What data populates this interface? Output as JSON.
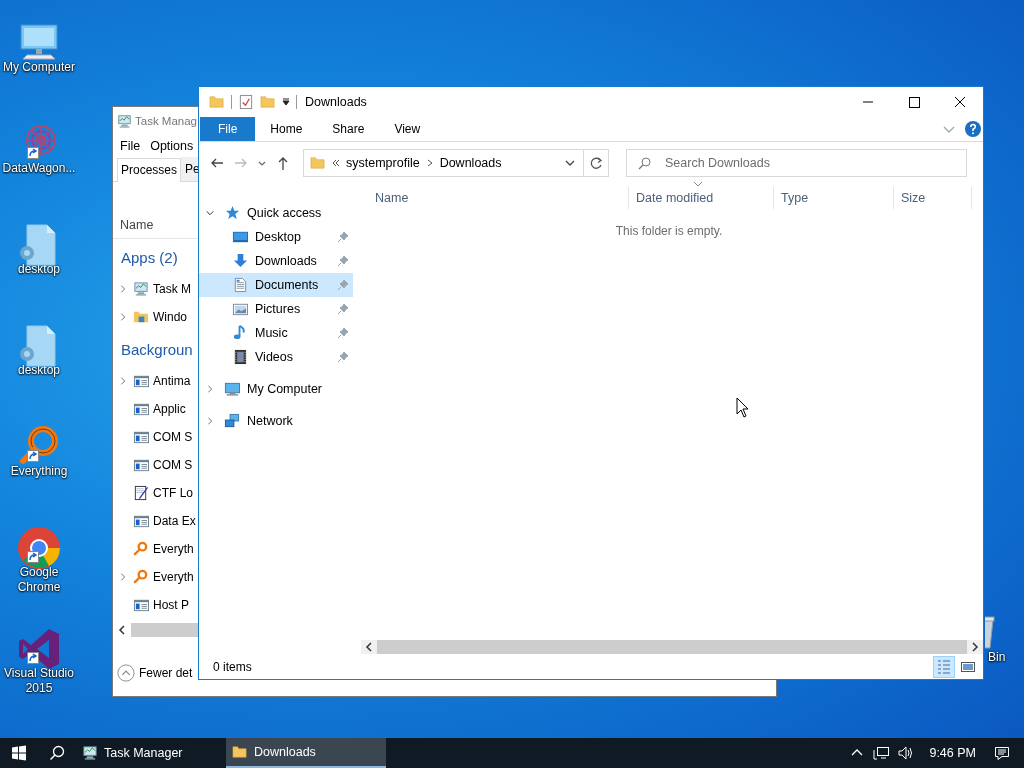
{
  "desktop_icons": [
    {
      "label": "My Computer",
      "kind": "computer",
      "shortcut": false
    },
    {
      "label": "DataWagon...",
      "kind": "app",
      "shortcut": true
    },
    {
      "label": "desktop",
      "kind": "file",
      "shortcut": false
    },
    {
      "label": "desktop",
      "kind": "file",
      "shortcut": false
    },
    {
      "label": "Everything",
      "kind": "everything",
      "shortcut": true
    },
    {
      "label": "Google Chrome",
      "kind": "chrome",
      "shortcut": true
    },
    {
      "label": "Visual Studio 2015",
      "kind": "vs",
      "shortcut": true
    }
  ],
  "recycle_bin": {
    "label": "Bin"
  },
  "task_manager": {
    "title": "Task Manag",
    "menu": [
      "File",
      "Options"
    ],
    "tabs": [
      {
        "label": "Processes",
        "selected": true
      },
      {
        "label": "Pe",
        "selected": false
      }
    ],
    "column": "Name",
    "groups": [
      {
        "title": "Apps (2)",
        "processes": [
          {
            "name": "Task M",
            "kind": "taskmgr",
            "expandable": true
          },
          {
            "name": "Windo",
            "kind": "explorer",
            "expandable": true
          }
        ]
      },
      {
        "title": "Backgroun",
        "processes": [
          {
            "name": "Antima",
            "kind": "service",
            "expandable": true
          },
          {
            "name": "Applic",
            "kind": "service",
            "expandable": false
          },
          {
            "name": "COM S",
            "kind": "service",
            "expandable": false
          },
          {
            "name": "COM S",
            "kind": "service",
            "expandable": false
          },
          {
            "name": "CTF Lo",
            "kind": "ctf",
            "expandable": false
          },
          {
            "name": "Data Ex",
            "kind": "service",
            "expandable": false
          },
          {
            "name": "Everyth",
            "kind": "everything",
            "expandable": false
          },
          {
            "name": "Everyth",
            "kind": "everything",
            "expandable": true
          },
          {
            "name": "Host P",
            "kind": "service",
            "expandable": false
          }
        ]
      }
    ],
    "footer": "Fewer det"
  },
  "explorer": {
    "title": "Downloads",
    "ribbon_tabs": [
      {
        "label": "File",
        "kind": "file"
      },
      {
        "label": "Home",
        "kind": "tab"
      },
      {
        "label": "Share",
        "kind": "tab"
      },
      {
        "label": "View",
        "kind": "tab"
      }
    ],
    "breadcrumb": [
      "systemprofile",
      "Downloads"
    ],
    "search": {
      "placeholder": "Search Downloads"
    },
    "columns": [
      {
        "label": "Name",
        "sorted": false
      },
      {
        "label": "Date modified",
        "sorted": true
      },
      {
        "label": "Type",
        "sorted": false
      },
      {
        "label": "Size",
        "sorted": false
      }
    ],
    "empty_message": "This folder is empty.",
    "nav": [
      {
        "label": "Quick access",
        "kind": "star",
        "expanded": true,
        "selected": false,
        "children": [
          {
            "label": "Desktop",
            "kind": "desktop",
            "pinned": true,
            "selected": false
          },
          {
            "label": "Downloads",
            "kind": "download",
            "pinned": true,
            "selected": false
          },
          {
            "label": "Documents",
            "kind": "document",
            "pinned": true,
            "selected": true
          },
          {
            "label": "Pictures",
            "kind": "pictures",
            "pinned": true,
            "selected": false
          },
          {
            "label": "Music",
            "kind": "music",
            "pinned": true,
            "selected": false
          },
          {
            "label": "Videos",
            "kind": "videos",
            "pinned": true,
            "selected": false
          }
        ]
      },
      {
        "label": "My Computer",
        "kind": "computer",
        "expanded": false,
        "selected": false
      },
      {
        "label": "Network",
        "kind": "network",
        "expanded": false,
        "selected": false
      }
    ],
    "status": "0 items",
    "views": [
      {
        "kind": "details",
        "selected": true
      },
      {
        "kind": "tiles",
        "selected": false
      }
    ]
  },
  "taskbar": {
    "items": [
      {
        "label": "Task Manager",
        "kind": "taskmgr",
        "active": false
      },
      {
        "label": "Downloads",
        "kind": "folder",
        "active": true
      }
    ],
    "time": "9:46 PM"
  }
}
